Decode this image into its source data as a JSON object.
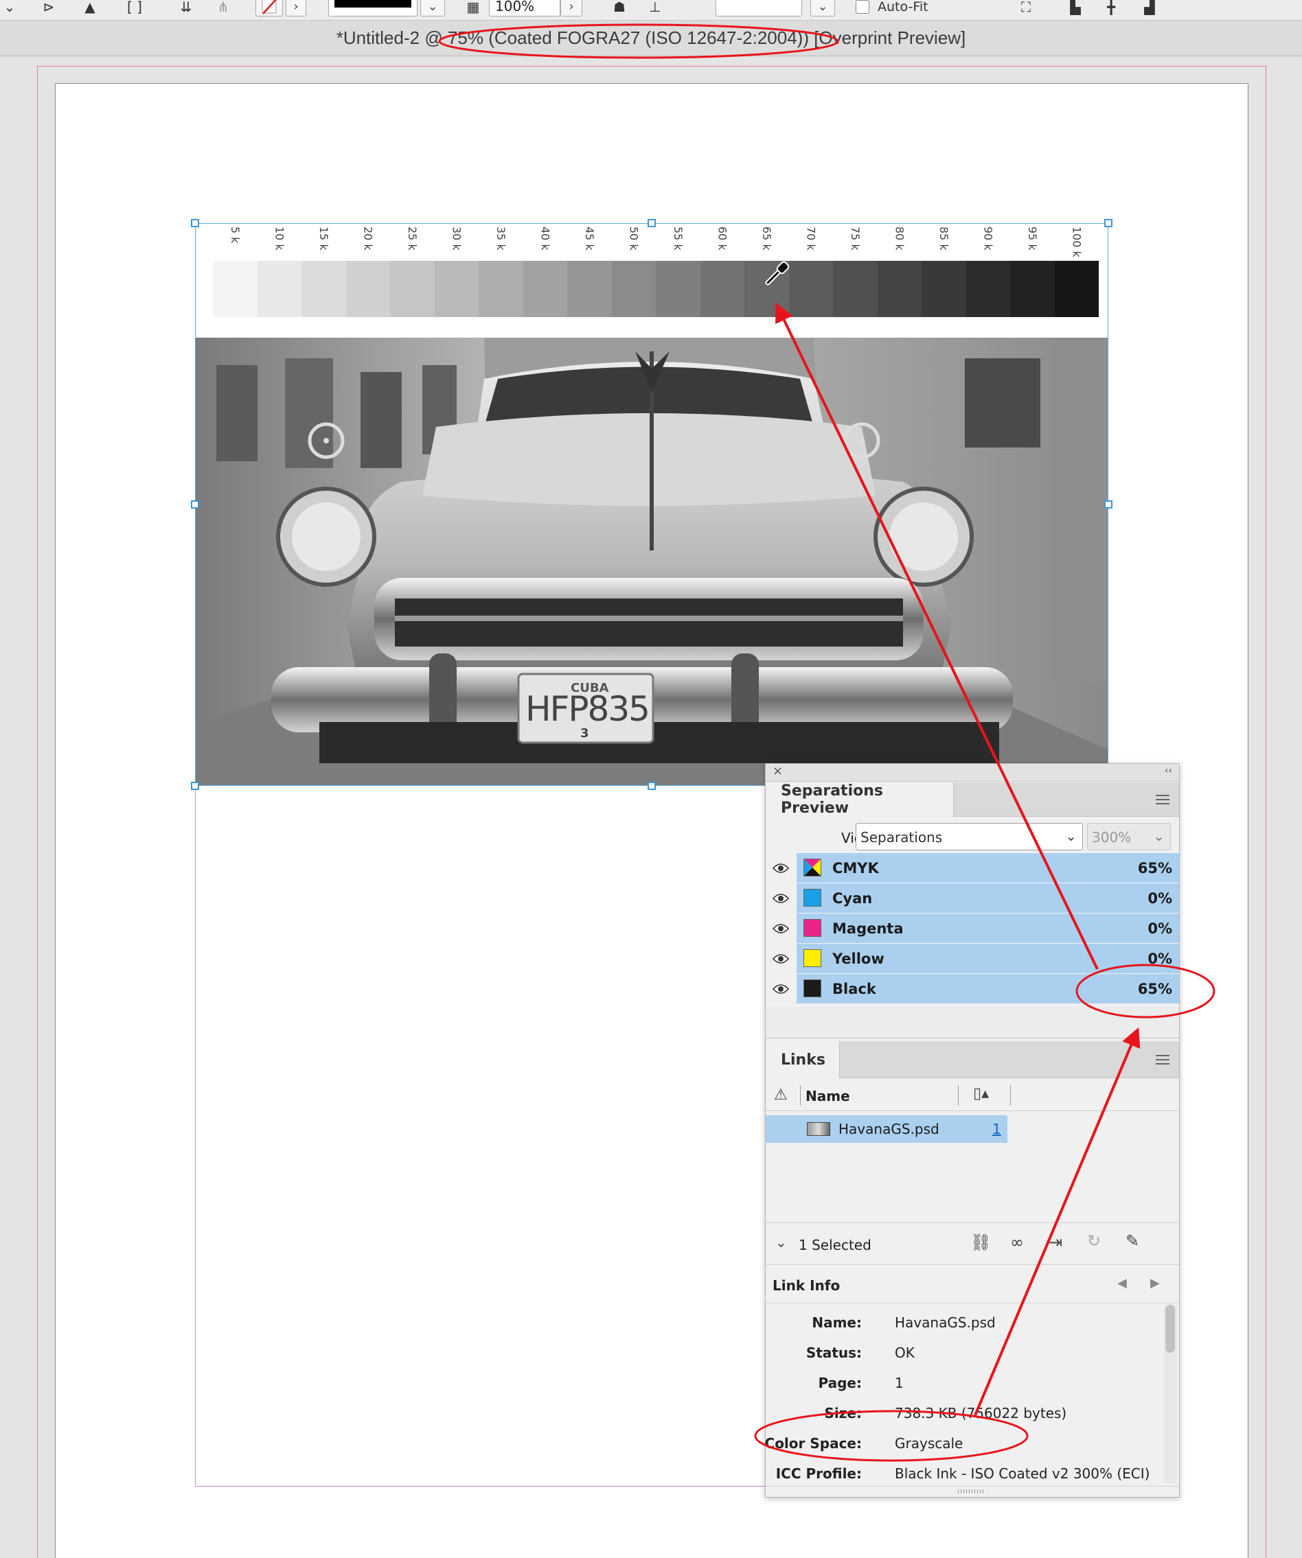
{
  "toolbar": {
    "opacity_value": "100%",
    "autofit_label": "Auto-Fit"
  },
  "window": {
    "title": "*Untitled-2 @ 75% (Coated FOGRA27 (ISO 12647-2:2004)) [Overprint Preview]"
  },
  "tint_strip": {
    "labels": [
      "5 k",
      "10 k",
      "15 k",
      "20 k",
      "25 k",
      "30 k",
      "35 k",
      "40 k",
      "45 k",
      "50 k",
      "55 k",
      "60 k",
      "65 k",
      "70 k",
      "75 k",
      "80 k",
      "85 k",
      "90 k",
      "95 k",
      "100 k"
    ],
    "tints_percent": [
      5,
      10,
      15,
      20,
      25,
      30,
      35,
      40,
      45,
      50,
      55,
      60,
      65,
      70,
      75,
      80,
      85,
      90,
      95,
      100
    ]
  },
  "photo": {
    "plate_country": "CUBA",
    "plate_number": "HFP835",
    "plate_sub": "3"
  },
  "separations_panel": {
    "tab": "Separations Preview",
    "view_label": "View:",
    "view_value": "Separations",
    "ink_limit": "300%",
    "rows": [
      {
        "name": "CMYK",
        "value": "65%",
        "color": "cmyk"
      },
      {
        "name": "Cyan",
        "value": "0%",
        "color": "#1aa0e6"
      },
      {
        "name": "Magenta",
        "value": "0%",
        "color": "#e8248a"
      },
      {
        "name": "Yellow",
        "value": "0%",
        "color": "#ffee00"
      },
      {
        "name": "Black",
        "value": "65%",
        "color": "#1a1a1a"
      }
    ]
  },
  "links_panel": {
    "tab": "Links",
    "col_name": "Name",
    "file_name": "HavanaGS.psd",
    "file_page": "1",
    "selected_text": "1 Selected"
  },
  "link_info": {
    "title": "Link Info",
    "rows": [
      {
        "key": "Name:",
        "value": "HavanaGS.psd"
      },
      {
        "key": "Status:",
        "value": "OK"
      },
      {
        "key": "Page:",
        "value": "1"
      },
      {
        "key": "Size:",
        "value": "738.3 KB (756022 bytes)"
      },
      {
        "key": "Color Space:",
        "value": "Grayscale"
      },
      {
        "key": "ICC Profile:",
        "value": "Black Ink - ISO Coated v2 300% (ECI)"
      }
    ]
  },
  "colors": {
    "accent_red": "#e8141c",
    "selection_blue": "#abd0ef",
    "frame_blue": "#3d95d8"
  }
}
